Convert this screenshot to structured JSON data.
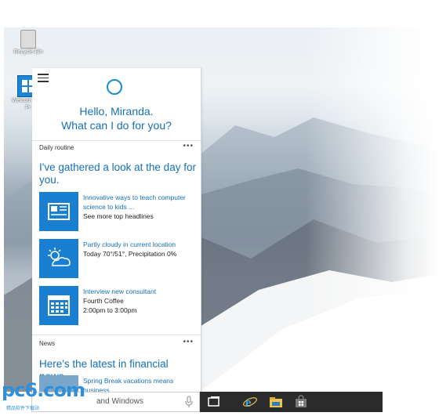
{
  "desktop": {
    "icons": [
      {
        "label": "Recycle Bin",
        "icon": "recycle-bin-icon"
      },
      {
        "label": "Welcom Tech Pr",
        "icon": "welcome-app-icon"
      }
    ]
  },
  "cortana": {
    "greeting_line1": "Hello, Miranda.",
    "greeting_line2": "What can I do for you?",
    "daily": {
      "title": "Daily routine",
      "more": "•••",
      "headline": "I've gathered a look at the day for you.",
      "items": [
        {
          "icon": "news-icon",
          "link": "Innovative ways to teach computer science to kids ...",
          "detail": "See more top headlines"
        },
        {
          "icon": "weather-partly-cloudy-icon",
          "link": "Partly cloudy in current location",
          "detail": "Today 70°/51°, Precipitation 0%"
        },
        {
          "icon": "calendar-icon",
          "link": "Interview new consultant",
          "detail": "Fourth Coffee",
          "detail2": "2:00pm to 3:00pm"
        }
      ]
    },
    "news": {
      "title": "News",
      "more": "•••",
      "headline": "Here's the latest in financial news.",
      "item_link": "Spring Break vacations means business"
    }
  },
  "taskbar": {
    "search_placeholder": "and Windows"
  },
  "watermark": {
    "brand": "pc6.com",
    "sub": "精品软件下载站"
  },
  "colors": {
    "accent": "#1a7fd0",
    "link": "#1570b8",
    "taskbar": "#2b2b2b"
  }
}
